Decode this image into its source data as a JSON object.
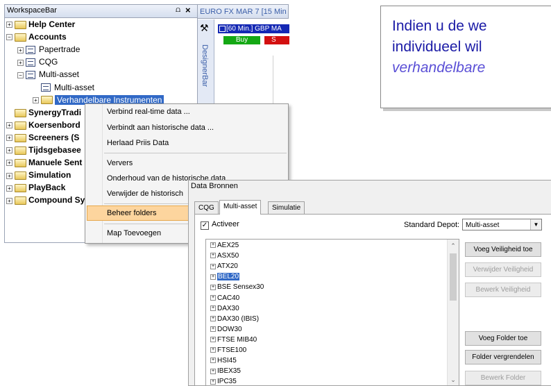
{
  "callout": {
    "line1": "Indien u de we",
    "line2": "individueel wil",
    "line3": "verhandelbare"
  },
  "workspace_bar": {
    "title": "WorkspaceBar",
    "pin_glyph": "⩍",
    "close_glyph": "×",
    "tree": [
      {
        "label": "Help Center",
        "bold": true,
        "expander": "+",
        "icon": "folder-icon"
      },
      {
        "label": "Accounts",
        "bold": true,
        "expander": "−",
        "icon": "folder-open-icon"
      },
      {
        "label": "Papertrade",
        "bold": false,
        "expander": "+",
        "icon": "account-icon"
      },
      {
        "label": "CQG",
        "bold": false,
        "expander": "+",
        "icon": "account-icon"
      },
      {
        "label": "Multi-asset",
        "bold": false,
        "expander": "−",
        "icon": "account-icon"
      },
      {
        "label": "Multi-asset",
        "bold": false,
        "expander": "",
        "icon": "account-icon"
      },
      {
        "label": "Verhandelbare Instrumenten",
        "bold": false,
        "expander": "+",
        "icon": "folder-icon",
        "selected": true
      },
      {
        "label": "SynergyTradi",
        "bold": true,
        "expander": "",
        "icon": "folder-icon"
      },
      {
        "label": "Koersenbord",
        "bold": true,
        "expander": "+",
        "icon": "folder-icon"
      },
      {
        "label": "Screeners (S",
        "bold": true,
        "expander": "+",
        "icon": "folder-icon"
      },
      {
        "label": "Tijdsgebasee",
        "bold": true,
        "expander": "+",
        "icon": "folder-icon"
      },
      {
        "label": "Manuele Sent",
        "bold": true,
        "expander": "+",
        "icon": "folder-icon"
      },
      {
        "label": "Simulation",
        "bold": true,
        "expander": "+",
        "icon": "folder-icon"
      },
      {
        "label": "PlayBack",
        "bold": true,
        "expander": "+",
        "icon": "folder-icon"
      },
      {
        "label": "Compound Sy",
        "bold": true,
        "expander": "+",
        "icon": "folder-icon"
      }
    ]
  },
  "chart_pane": {
    "tab_label": "EURO FX MAR 7 [15 Min",
    "designer_label": "DesignerBar",
    "header": "[60 Min.] GBP MA",
    "buy_label": "Buy",
    "sell_label": "S"
  },
  "context_menu": {
    "items": [
      "Verbind real-time data ...",
      "Verbindt aan historische data ...",
      "Herlaad Priis Data",
      "Ververs",
      "Onderhoud van de historische data",
      "Verwijder de historisch",
      "Beheer folders",
      "Map Toevoegen"
    ],
    "highlighted": "Beheer folders"
  },
  "dialog": {
    "title": "Data Bronnen",
    "tabs": [
      "CQG",
      "Multi-asset",
      "Simulatie"
    ],
    "active_tab": "Multi-asset",
    "activeer_label": "Activeer",
    "activeer_checked": true,
    "depot_label": "Standard Depot:",
    "depot_value": "Multi-asset",
    "instruments": [
      "AEX25",
      "ASX50",
      "ATX20",
      "BEL20",
      "BSE Sensex30",
      "CAC40",
      "DAX30",
      "DAX30 (IBIS)",
      "DOW30",
      "FTSE MIB40",
      "FTSE100",
      "HSI45",
      "IBEX35",
      "IPC35"
    ],
    "selected_instrument": "BEL20",
    "buttons": [
      {
        "label": "Voeg Veiligheid toe",
        "enabled": true
      },
      {
        "label": "Verwijder Veiligheid",
        "enabled": false
      },
      {
        "label": "Bewerk Veiligheid",
        "enabled": false
      },
      {
        "label": "Voeg Folder toe",
        "enabled": true
      },
      {
        "label": "Folder vergrendelen",
        "enabled": true
      },
      {
        "label": "Bewerk Folder",
        "enabled": false
      }
    ]
  }
}
